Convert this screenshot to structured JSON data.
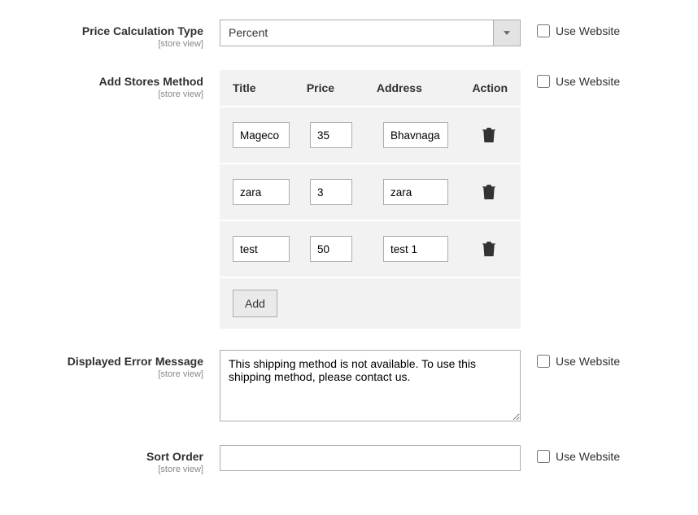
{
  "fields": {
    "price_calc": {
      "label": "Price Calculation Type",
      "scope": "[store view]",
      "value": "Percent",
      "use_website": "Use Website"
    },
    "add_stores": {
      "label": "Add Stores Method",
      "scope": "[store view]",
      "use_website": "Use Website",
      "add_btn": "Add",
      "headers": {
        "title": "Title",
        "price": "Price",
        "address": "Address",
        "action": "Action"
      },
      "rows": [
        {
          "title": "Mageco",
          "price": "35",
          "address": "Bhavnaga"
        },
        {
          "title": "zara",
          "price": "3",
          "address": "zara"
        },
        {
          "title": "test",
          "price": "50",
          "address": "test 1"
        }
      ]
    },
    "error_msg": {
      "label": "Displayed Error Message",
      "scope": "[store view]",
      "value": "This shipping method is not available. To use this shipping method, please contact us.",
      "use_website": "Use Website"
    },
    "sort_order": {
      "label": "Sort Order",
      "scope": "[store view]",
      "value": "",
      "use_website": "Use Website"
    }
  }
}
